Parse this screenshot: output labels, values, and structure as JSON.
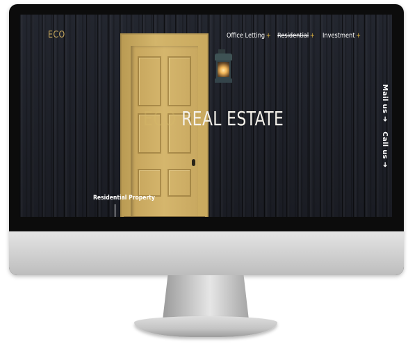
{
  "site": {
    "logo": "ECO",
    "nav": [
      {
        "label": "Office Letting",
        "marker": "+"
      },
      {
        "label": "Residential",
        "marker": "+"
      },
      {
        "label": "Investment",
        "marker": "+"
      }
    ],
    "hero": {
      "prefix": "ECO",
      "title": "REAL ESTATE"
    },
    "contact": {
      "mail": "Mail us ➜",
      "call": "Call us ➜"
    },
    "section_label": "Residential Property"
  },
  "colors": {
    "accent_gold": "#c7a85d",
    "marker_yellow": "#e2b640",
    "text_white": "#ffffff",
    "wall_dark": "#1c1f27"
  },
  "icons": {
    "nav_marker": "plus-icon",
    "contact_arrow": "arrow-right-icon"
  }
}
